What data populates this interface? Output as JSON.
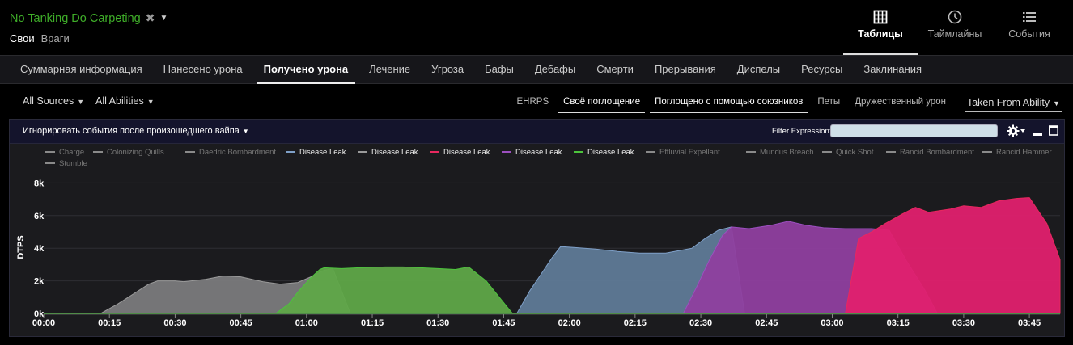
{
  "header": {
    "title": "No Tanking Do Carpeting",
    "side_active": "Свои",
    "side_inactive": "Враги",
    "view_tabs": [
      {
        "label": "Таблицы",
        "icon": "table-grid-icon",
        "active": true
      },
      {
        "label": "Таймлайны",
        "icon": "clock-icon",
        "active": false
      },
      {
        "label": "События",
        "icon": "list-icon",
        "active": false
      }
    ]
  },
  "main_tabs": [
    {
      "label": "Суммарная информация"
    },
    {
      "label": "Нанесено урона"
    },
    {
      "label": "Получено урона",
      "active": true
    },
    {
      "label": "Лечение"
    },
    {
      "label": "Угроза"
    },
    {
      "label": "Бафы"
    },
    {
      "label": "Дебафы"
    },
    {
      "label": "Смерти"
    },
    {
      "label": "Прерывания"
    },
    {
      "label": "Диспелы"
    },
    {
      "label": "Ресурсы"
    },
    {
      "label": "Заклинания"
    }
  ],
  "filters": {
    "sources": "All Sources",
    "abilities": "All Abilities",
    "sub_tabs": [
      {
        "label": "EHRPS",
        "active": false
      },
      {
        "label": "Своё поглощение",
        "active": true
      },
      {
        "label": "Поглощено с помощью союзников",
        "active": true
      },
      {
        "label": "Петы",
        "active": false
      },
      {
        "label": "Дружественный урон",
        "active": false
      }
    ],
    "taken_from": "Taken From Ability"
  },
  "panel": {
    "ignore_label": "Игнорировать события после произошедшего вайпа",
    "filter_label": "Filter Expression:",
    "filter_value": ""
  },
  "chart_data": {
    "type": "area",
    "ylabel": "DTPS",
    "xlabel": "",
    "ylim": [
      0,
      10000
    ],
    "xlim": [
      0,
      232
    ],
    "y_ticks": [
      0,
      2000,
      4000,
      6000,
      8000
    ],
    "y_tick_labels": [
      "0k",
      "2k",
      "4k",
      "6k",
      "8k"
    ],
    "x_ticks": [
      0,
      15,
      30,
      45,
      60,
      75,
      90,
      105,
      120,
      135,
      150,
      165,
      180,
      195,
      210,
      225
    ],
    "x_tick_labels": [
      "00:00",
      "00:15",
      "00:30",
      "00:45",
      "01:00",
      "01:15",
      "01:30",
      "01:45",
      "02:00",
      "02:15",
      "02:30",
      "02:45",
      "03:00",
      "03:15",
      "03:30",
      "03:45"
    ],
    "grid": true,
    "legend_position": "top",
    "legend": [
      {
        "name": "Charge",
        "color": "#8a8a8a",
        "active": false
      },
      {
        "name": "Colonizing Quills",
        "color": "#8a8a8a",
        "active": false
      },
      {
        "name": "Daedric Bombardment",
        "color": "#8a8a8a",
        "active": false
      },
      {
        "name": "Disease Leak",
        "color": "#7fa0c8",
        "active": true
      },
      {
        "name": "Disease Leak",
        "color": "#9a9a9a",
        "active": true
      },
      {
        "name": "Disease Leak",
        "color": "#e8285f",
        "active": true
      },
      {
        "name": "Disease Leak",
        "color": "#9c4fc0",
        "active": true
      },
      {
        "name": "Disease Leak",
        "color": "#4cc43c",
        "active": true
      },
      {
        "name": "Effluvial Expellant",
        "color": "#8a8a8a",
        "active": false
      },
      {
        "name": "Mundus Breach",
        "color": "#8a8a8a",
        "active": false
      },
      {
        "name": "Quick Shot",
        "color": "#8a8a8a",
        "active": false
      },
      {
        "name": "Rancid Bombardment",
        "color": "#8a8a8a",
        "active": false
      },
      {
        "name": "Rancid Hammer",
        "color": "#8a8a8a",
        "active": false
      },
      {
        "name": "Stumble",
        "color": "#8a8a8a",
        "active": false
      }
    ],
    "series": [
      {
        "name": "Disease Leak",
        "color": "#9a9a9a",
        "fill": "#7a7a7c",
        "points": [
          [
            0,
            0
          ],
          [
            13,
            0
          ],
          [
            17,
            600
          ],
          [
            24,
            1800
          ],
          [
            26,
            2000
          ],
          [
            30,
            2000
          ],
          [
            32,
            1950
          ],
          [
            37,
            2100
          ],
          [
            41,
            2300
          ],
          [
            45,
            2250
          ],
          [
            50,
            1950
          ],
          [
            54,
            1800
          ],
          [
            58,
            1900
          ],
          [
            61,
            2250
          ],
          [
            64,
            2650
          ],
          [
            66,
            2750
          ],
          [
            70,
            0
          ],
          [
            71,
            0
          ]
        ]
      },
      {
        "name": "Disease Leak",
        "color": "#4cc43c",
        "fill": "#5fa648",
        "points": [
          [
            52,
            0
          ],
          [
            53,
            0
          ],
          [
            56,
            600
          ],
          [
            58,
            1300
          ],
          [
            61,
            2200
          ],
          [
            63,
            2700
          ],
          [
            64,
            2800
          ],
          [
            68,
            2750
          ],
          [
            72,
            2800
          ],
          [
            78,
            2850
          ],
          [
            82,
            2850
          ],
          [
            86,
            2800
          ],
          [
            90,
            2750
          ],
          [
            94,
            2700
          ],
          [
            97,
            2850
          ],
          [
            101,
            2000
          ],
          [
            104,
            1000
          ],
          [
            107,
            0
          ],
          [
            108,
            0
          ]
        ]
      },
      {
        "name": "Disease Leak",
        "color": "#7fa0c8",
        "fill": "#5f7a97",
        "points": [
          [
            105,
            0
          ],
          [
            108,
            0
          ],
          [
            111,
            1400
          ],
          [
            114,
            2600
          ],
          [
            116,
            3400
          ],
          [
            118,
            4100
          ],
          [
            121,
            4050
          ],
          [
            126,
            3950
          ],
          [
            131,
            3800
          ],
          [
            136,
            3700
          ],
          [
            142,
            3700
          ],
          [
            146,
            3900
          ],
          [
            148,
            4000
          ],
          [
            151,
            4600
          ],
          [
            154,
            5100
          ],
          [
            157,
            5300
          ],
          [
            160,
            0
          ],
          [
            161,
            0
          ]
        ]
      },
      {
        "name": "Disease Leak",
        "color": "#9c4fc0",
        "fill": "#8f3f9f",
        "points": [
          [
            145,
            0
          ],
          [
            146,
            0
          ],
          [
            149,
            1600
          ],
          [
            152,
            3300
          ],
          [
            155,
            4800
          ],
          [
            157,
            5300
          ],
          [
            161,
            5200
          ],
          [
            166,
            5400
          ],
          [
            170,
            5650
          ],
          [
            174,
            5400
          ],
          [
            178,
            5250
          ],
          [
            183,
            5200
          ],
          [
            189,
            5200
          ],
          [
            193,
            5100
          ],
          [
            197,
            3200
          ],
          [
            201,
            1500
          ],
          [
            204,
            0
          ],
          [
            205,
            0
          ]
        ]
      },
      {
        "name": "Disease Leak",
        "color": "#e8285f",
        "fill": "#e0206e",
        "points": [
          [
            182,
            0
          ],
          [
            183,
            0
          ],
          [
            186,
            4600
          ],
          [
            189,
            5000
          ],
          [
            192,
            5500
          ],
          [
            196,
            6100
          ],
          [
            199,
            6500
          ],
          [
            202,
            6200
          ],
          [
            207,
            6400
          ],
          [
            210,
            6600
          ],
          [
            214,
            6500
          ],
          [
            218,
            6900
          ],
          [
            222,
            7050
          ],
          [
            225,
            7100
          ],
          [
            229,
            5500
          ],
          [
            232,
            3300
          ],
          [
            232,
            0
          ]
        ]
      }
    ]
  }
}
